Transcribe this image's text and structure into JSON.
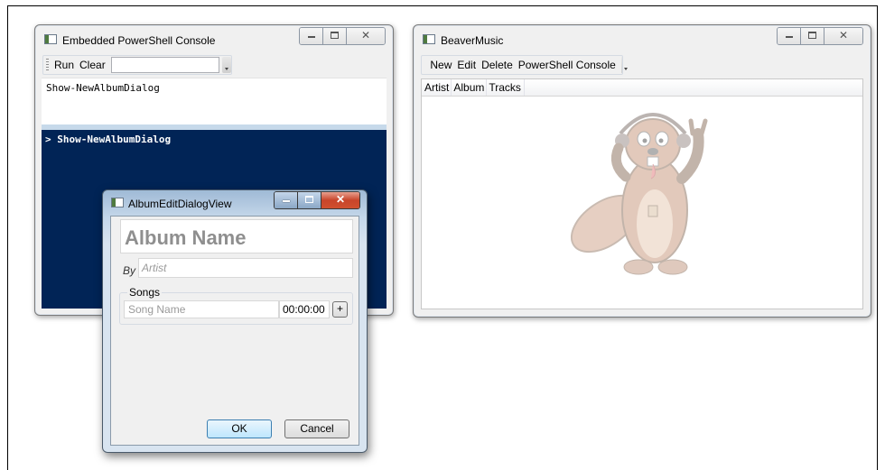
{
  "console_window": {
    "title": "Embedded PowerShell Console",
    "toolbar": {
      "run": "Run",
      "clear": "Clear",
      "input_value": ""
    },
    "editor_text": "Show-NewAlbumDialog",
    "output_line": "> Show-NewAlbumDialog",
    "output_bg": "#012456"
  },
  "beaver_window": {
    "title": "BeaverMusic",
    "toolbar": {
      "new": "New",
      "edit": "Edit",
      "delete": "Delete",
      "console": "PowerShell Console"
    },
    "columns": [
      "Artist",
      "Album",
      "Tracks"
    ]
  },
  "dialog": {
    "title": "AlbumEditDialogView",
    "album_placeholder": "Album Name",
    "by_label": "By",
    "artist_placeholder": "Artist",
    "songs_label": "Songs",
    "song_placeholder": "Song Name",
    "duration": "00:00:00",
    "add": "+",
    "ok": "OK",
    "cancel": "Cancel"
  },
  "icons": {
    "minimize": "minimize-icon",
    "maximize": "maximize-icon",
    "close": "close-icon",
    "window": "window-icon",
    "mascot": "beaver-mascot"
  }
}
